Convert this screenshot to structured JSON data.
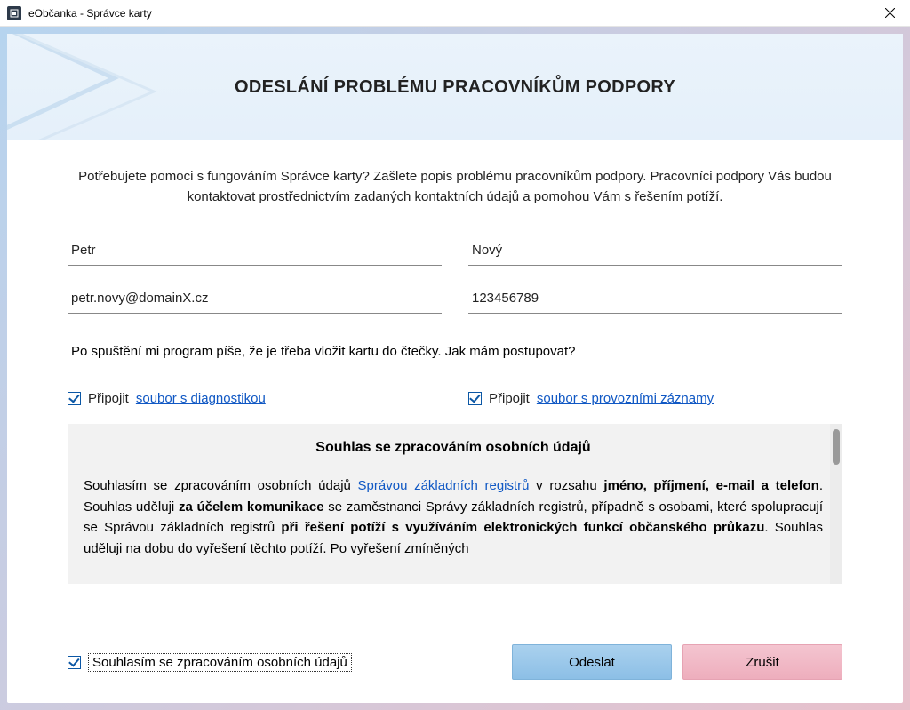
{
  "window": {
    "title": "eObčanka - Správce karty"
  },
  "header": {
    "title": "ODESLÁNÍ PROBLÉMU PRACOVNÍKŮM PODPORY"
  },
  "intro": "Potřebujete pomoci s fungováním Správce karty? Zašlete popis problému pracovníkům podpory. Pracovníci podpory Vás budou kontaktovat prostřednictvím zadaných kontaktních údajů a pomohou Vám s řešením potíží.",
  "form": {
    "first_name": "Petr",
    "last_name": "Nový",
    "email": "petr.novy@domainX.cz",
    "phone": "123456789",
    "description": "Po spuštění mi program píše, že je třeba vložit kartu do čtečky. Jak mám postupovat?"
  },
  "attachments": {
    "diag": {
      "checked": true,
      "label": "Připojit",
      "link": "soubor s diagnostikou"
    },
    "logs": {
      "checked": true,
      "label": "Připojit",
      "link": "soubor s provozními záznamy"
    }
  },
  "consent": {
    "heading": "Souhlas se zpracováním osobních údajů",
    "p1_a": "Souhlasím se zpracováním osobních údajů ",
    "p1_link": "Správou základních registrů",
    "p1_b": " v rozsahu ",
    "p1_bold1": "jméno, příjmení, e-mail a telefon",
    "p1_c": ". Souhlas uděluji ",
    "p1_bold2": "za účelem komunikace",
    "p1_d": " se zaměstnanci Správy základních registrů, případně s osobami, které spolupracují se Správou základních registrů ",
    "p1_bold3": "při řešení potíží s využíváním elektronických funkcí občanského průkazu",
    "p1_e": ". Souhlas uděluji na dobu do vyřešení těchto potíží. Po vyřešení zmíněných"
  },
  "agree": {
    "checked": true,
    "label": "Souhlasím se zpracováním osobních údajů"
  },
  "buttons": {
    "send": "Odeslat",
    "cancel": "Zrušit"
  }
}
